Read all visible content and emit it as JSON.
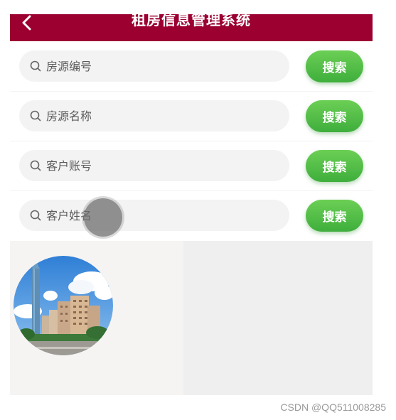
{
  "header": {
    "title": "租房信息管理系统",
    "background_color": "#9b0031"
  },
  "search_rows": [
    {
      "placeholder": "房源编号",
      "button_label": "搜索"
    },
    {
      "placeholder": "房源名称",
      "button_label": "搜索"
    },
    {
      "placeholder": "客户账号",
      "button_label": "搜索"
    },
    {
      "placeholder": "客户姓名",
      "button_label": "搜索"
    }
  ],
  "icons": {
    "back": "chevron-left-icon",
    "search": "search-icon"
  },
  "colors": {
    "accent_green": "#4cba45",
    "header": "#9b0031"
  },
  "watermark": "CSDN @QQ511008285"
}
